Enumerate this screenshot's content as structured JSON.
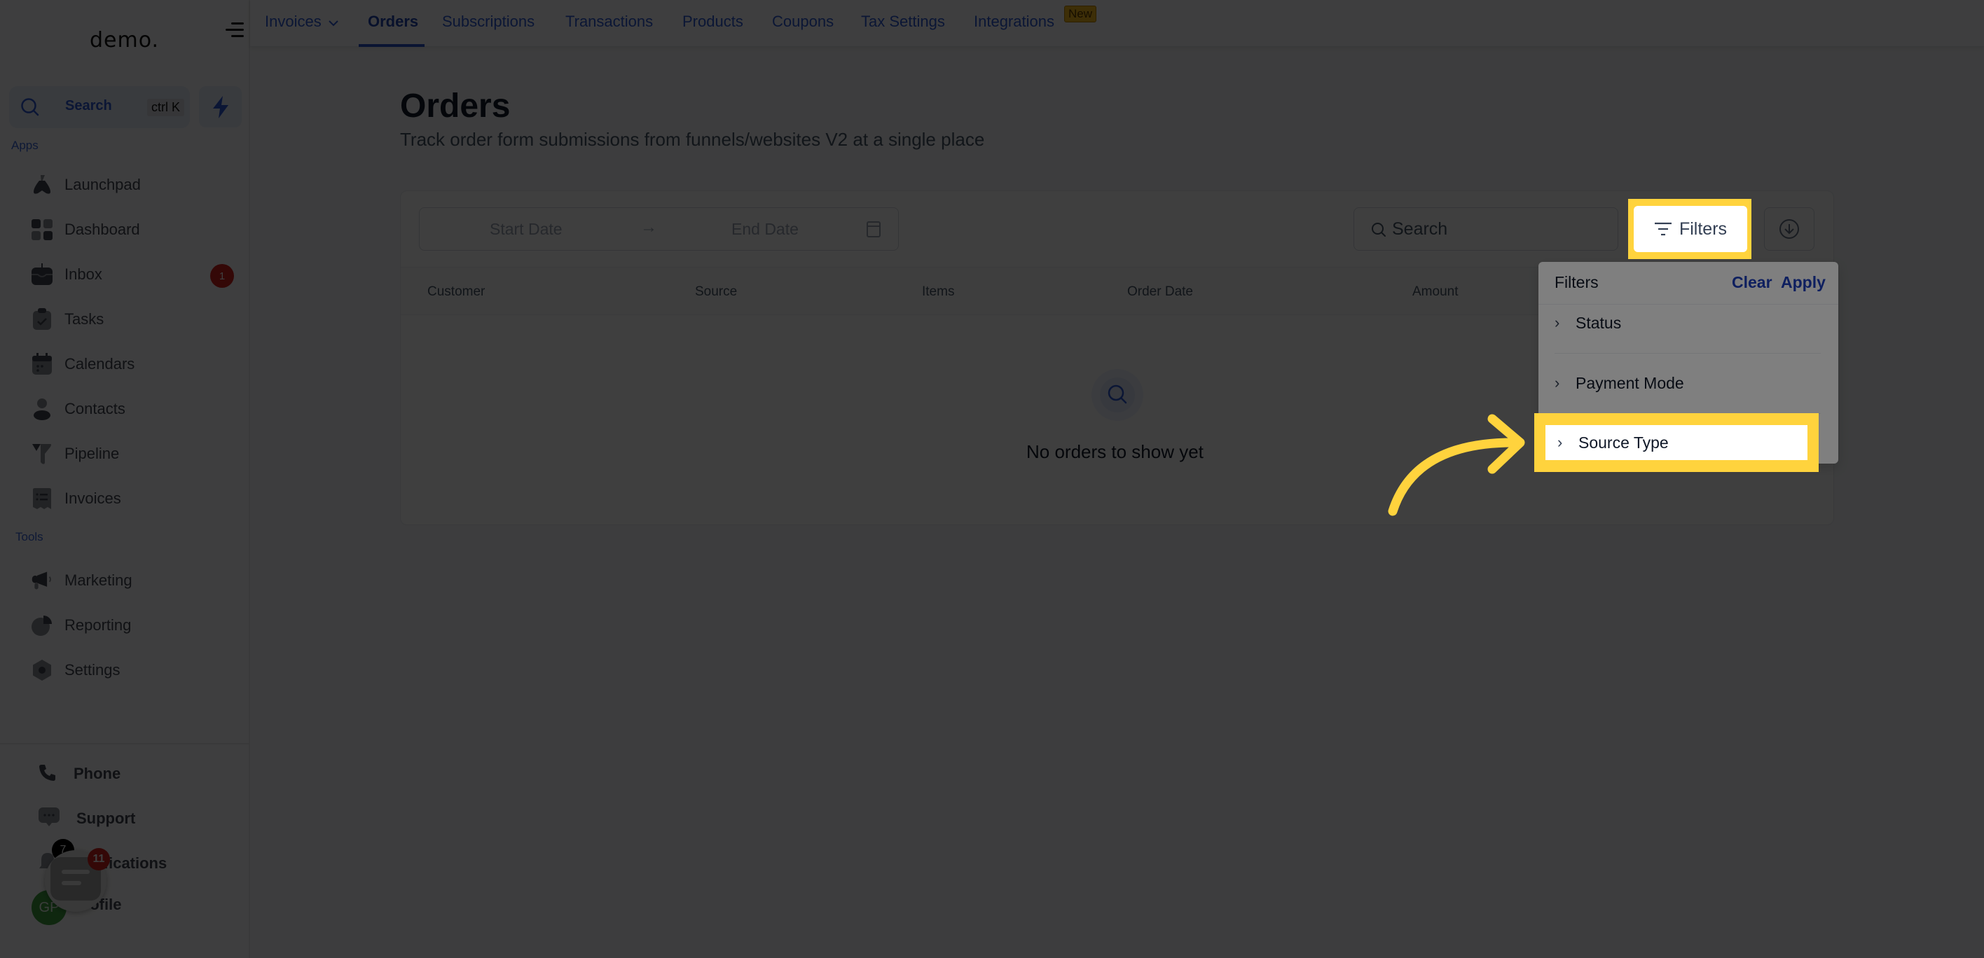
{
  "brand": {
    "logo_text": "demo."
  },
  "sidebar": {
    "search_label": "Search",
    "search_shortcut": "ctrl K",
    "sections": {
      "apps": "Apps",
      "tools": "Tools"
    },
    "apps": [
      {
        "label": "Launchpad",
        "icon": "rocket-icon"
      },
      {
        "label": "Dashboard",
        "icon": "dashboard-icon"
      },
      {
        "label": "Inbox",
        "icon": "inbox-icon",
        "badge": "1"
      },
      {
        "label": "Tasks",
        "icon": "clipboard-icon"
      },
      {
        "label": "Calendars",
        "icon": "calendar-icon"
      },
      {
        "label": "Contacts",
        "icon": "person-icon"
      },
      {
        "label": "Pipeline",
        "icon": "funnel-icon"
      },
      {
        "label": "Invoices",
        "icon": "receipt-icon"
      }
    ],
    "tools": [
      {
        "label": "Marketing",
        "icon": "megaphone-icon"
      },
      {
        "label": "Reporting",
        "icon": "pie-chart-icon"
      },
      {
        "label": "Settings",
        "icon": "gear-icon"
      }
    ],
    "bottom": [
      {
        "label": "Phone",
        "icon": "phone-icon"
      },
      {
        "label": "Support",
        "icon": "chat-icon"
      },
      {
        "label": "Notifications",
        "icon": "bell-icon",
        "badge": "7"
      },
      {
        "label": "Profile",
        "avatar_initials": "GP"
      }
    ],
    "chat_widget_badge": "11"
  },
  "topnav": {
    "tabs": [
      {
        "label": "Invoices",
        "has_dropdown": true
      },
      {
        "label": "Orders",
        "active": true
      },
      {
        "label": "Subscriptions"
      },
      {
        "label": "Transactions"
      },
      {
        "label": "Products"
      },
      {
        "label": "Coupons"
      },
      {
        "label": "Tax Settings"
      },
      {
        "label": "Integrations",
        "badge": "New"
      }
    ]
  },
  "page": {
    "title": "Orders",
    "subtitle": "Track order form submissions from funnels/websites V2 at a single place"
  },
  "toolbar": {
    "start_date_placeholder": "Start Date",
    "arrow": "→",
    "end_date_placeholder": "End Date",
    "search_placeholder": "Search",
    "filters_label": "Filters"
  },
  "table": {
    "columns": [
      "Customer",
      "Source",
      "Items",
      "Order Date",
      "Amount"
    ],
    "rows": [],
    "empty_message": "No orders to show yet"
  },
  "filters_dropdown": {
    "title": "Filters",
    "clear_label": "Clear",
    "apply_label": "Apply",
    "items": [
      "Status",
      "Payment Mode",
      "Source Type"
    ],
    "highlighted_item": "Source Type"
  },
  "colors": {
    "accent": "#2d5bd6",
    "highlight": "#ffd33d",
    "badge_red": "#d0201f"
  }
}
